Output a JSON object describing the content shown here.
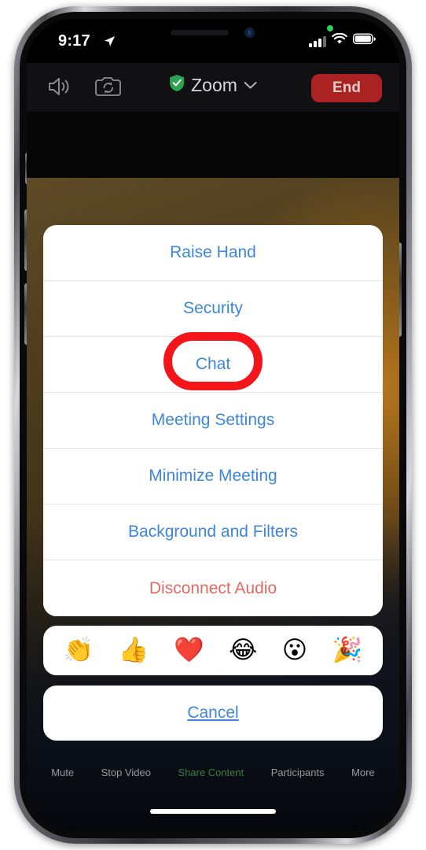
{
  "status_bar": {
    "time": "9:17",
    "location_icon": "location-arrow-icon",
    "recording_indicator": "green-recording-dot",
    "cellular_icon": "signal-bars-icon",
    "wifi_icon": "wifi-icon",
    "battery_icon": "battery-full-icon"
  },
  "zoom_header": {
    "speaker_icon": "speaker-icon",
    "camera_flip_icon": "camera-flip-icon",
    "shield_icon": "shield-check-icon",
    "title": "Zoom",
    "chevron_icon": "chevron-down-icon",
    "end_label": "End"
  },
  "action_sheet": {
    "menu_items": [
      {
        "label": "Raise Hand",
        "style": "default"
      },
      {
        "label": "Security",
        "style": "default"
      },
      {
        "label": "Chat",
        "style": "default",
        "highlighted": true
      },
      {
        "label": "Meeting Settings",
        "style": "default"
      },
      {
        "label": "Minimize Meeting",
        "style": "default"
      },
      {
        "label": "Background and Filters",
        "style": "default"
      },
      {
        "label": "Disconnect Audio",
        "style": "destructive"
      }
    ],
    "reactions": [
      {
        "name": "clapping-hands-emoji",
        "glyph": "👏"
      },
      {
        "name": "thumbs-up-emoji",
        "glyph": "👍"
      },
      {
        "name": "red-heart-emoji",
        "glyph": "❤️"
      },
      {
        "name": "tears-of-joy-emoji",
        "glyph": "😂"
      },
      {
        "name": "open-mouth-emoji",
        "glyph": "😮"
      },
      {
        "name": "party-popper-emoji",
        "glyph": "🎉"
      }
    ],
    "cancel_label": "Cancel"
  },
  "meeting_toolbar": [
    {
      "label": "Mute",
      "style": "default"
    },
    {
      "label": "Stop Video",
      "style": "default"
    },
    {
      "label": "Share Content",
      "style": "share"
    },
    {
      "label": "Participants",
      "style": "default"
    },
    {
      "label": "More",
      "style": "default"
    }
  ],
  "annotation": {
    "target": "Chat",
    "shape": "ellipse-outline",
    "color": "#f4151a"
  },
  "colors": {
    "accent_blue": "#3d87d8",
    "destructive_red": "#e06a63",
    "end_button_red": "#ab2222",
    "share_green": "#3a7d44",
    "annotation_red": "#f4151a",
    "sheet_white": "#ffffff"
  }
}
